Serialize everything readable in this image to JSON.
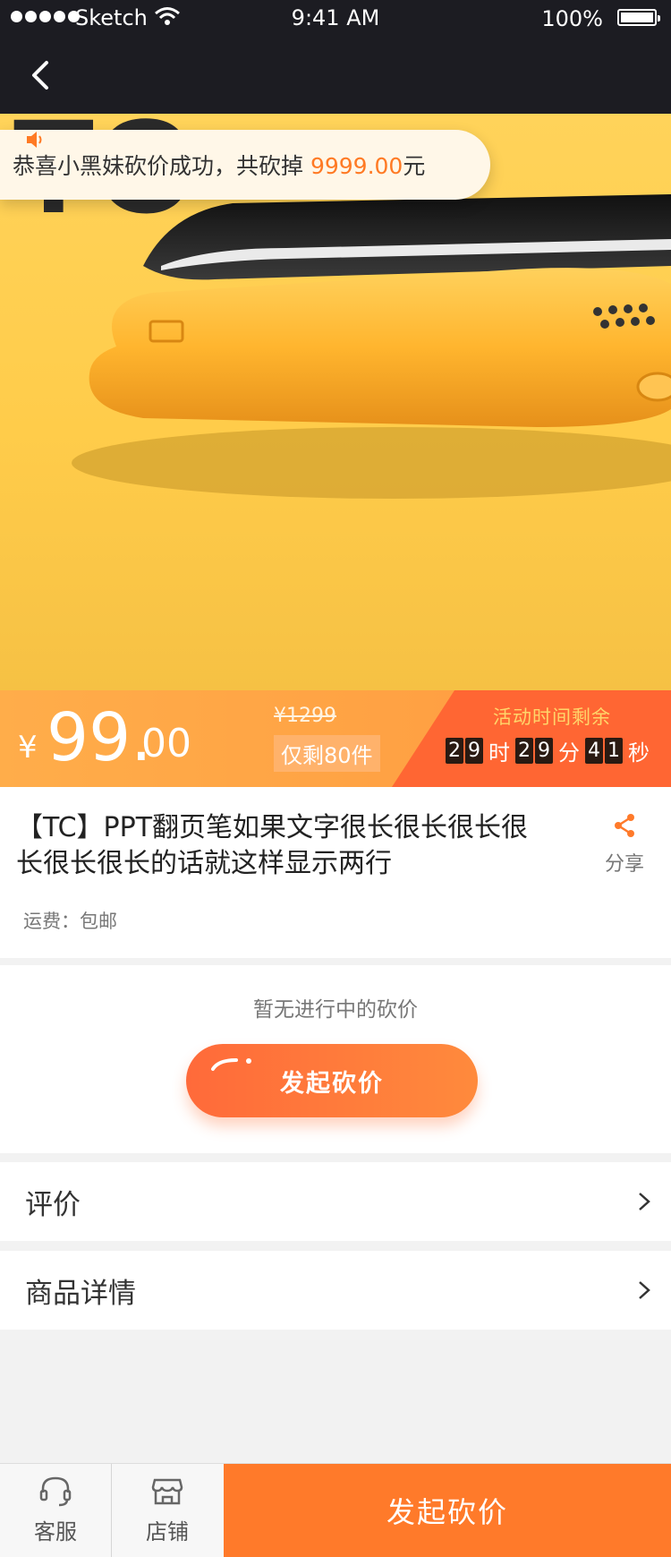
{
  "status_bar": {
    "carrier": "Sketch",
    "time": "9:41 AM",
    "battery": "100%"
  },
  "nav": {
    "back_icon": "chevron-left-icon"
  },
  "hero": {
    "toast": {
      "prefix": "恭喜小黑妹砍价成功，共砍掉 ",
      "amount": "9999.00",
      "suffix": "元"
    }
  },
  "price": {
    "currency": "¥",
    "integer": "99.",
    "decimal": "00",
    "original": "¥1299",
    "stock": "仅剩80件"
  },
  "countdown": {
    "title": "活动时间剩余",
    "hours": [
      "2",
      "9"
    ],
    "hours_unit": "时",
    "minutes": [
      "2",
      "9"
    ],
    "minutes_unit": "分",
    "seconds": [
      "4",
      "1"
    ],
    "seconds_unit": "秒"
  },
  "product": {
    "title": "【TC】PPT翻页笔如果文字很长很长很长很长很长很长的话就这样显示两行",
    "share_label": "分享",
    "shipping": "运费：包邮"
  },
  "bargain": {
    "empty_text": "暂无进行中的砍价",
    "start_button": "发起砍价"
  },
  "rows": [
    {
      "label": "评价"
    },
    {
      "label": "商品详情"
    }
  ],
  "bottom_bar": {
    "service_label": "客服",
    "shop_label": "店铺",
    "cta_label": "发起砍价"
  },
  "colors": {
    "accent": "#ff7a2a",
    "countdown_bg": "#ff6633",
    "hero_bg": "#ffcc4a"
  }
}
